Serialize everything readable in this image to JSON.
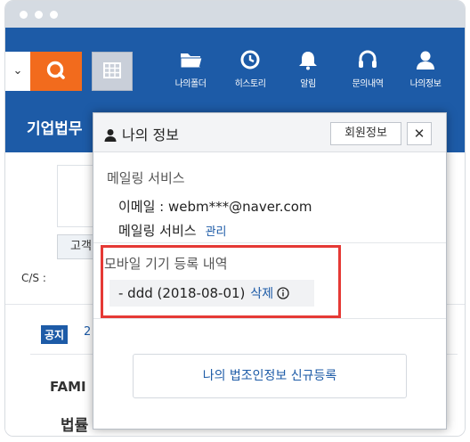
{
  "header": {
    "dropdown_chevron": "⌄",
    "search_icon": "search-icon",
    "grid_icon": "grid-icon",
    "nav": [
      {
        "label": "나의폴더",
        "icon": "folder-icon"
      },
      {
        "label": "히스토리",
        "icon": "history-icon"
      },
      {
        "label": "알림",
        "icon": "bell-icon"
      },
      {
        "label": "문의내역",
        "icon": "headset-icon"
      },
      {
        "label": "나의정보",
        "icon": "user-icon"
      }
    ]
  },
  "subnav": {
    "title": "기업법무"
  },
  "background": {
    "button_text": "고객",
    "cs_text": "C/S :",
    "notice_badge": "공지",
    "notice_count": "2",
    "fami_text": "FAMI",
    "law_text": "법률"
  },
  "popup": {
    "title": "나의 정보",
    "member_button": "회원정보",
    "close_button": "✕",
    "mailing_section_title": "메일링 서비스",
    "email_line": "이메일 : webm***@naver.com",
    "mailing_service_label": "메일링 서비스",
    "mailing_manage_link": "관리",
    "device_section_title": "모바일 기기 등록 내역",
    "device_entry": "- ddd (2018-08-01)",
    "device_delete_link": "삭제",
    "register_button": "나의 법조인정보 신규등록"
  },
  "colors": {
    "brand_blue": "#1d5ba7",
    "search_orange": "#f26b1d",
    "highlight_red": "#e53935"
  }
}
